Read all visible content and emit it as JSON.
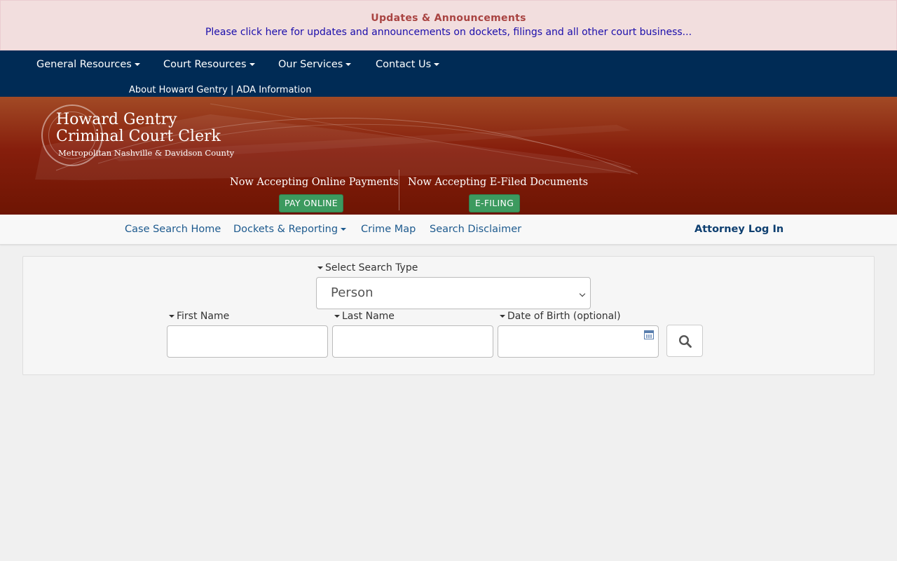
{
  "announcement": {
    "title": "Updates & Announcements",
    "link_text": "Please click here for updates and announcements on dockets, filings and all other court business..."
  },
  "top_nav": {
    "items": [
      {
        "label": "General Resources"
      },
      {
        "label": "Court Resources"
      },
      {
        "label": "Our Services"
      },
      {
        "label": "Contact Us"
      }
    ],
    "sub_links": {
      "about": "About Howard Gentry",
      "separator": " | ",
      "ada": "ADA Information"
    }
  },
  "banner": {
    "brand_name": "Howard Gentry",
    "brand_title": "Criminal Court Clerk",
    "brand_region": "Metropolitan Nashville & Davidson County",
    "payments_text": "Now Accepting Online Payments",
    "pay_button": "PAY ONLINE",
    "efile_text": "Now Accepting E-Filed Documents",
    "efile_button": "E-FILING"
  },
  "secondary_nav": {
    "items": [
      {
        "label": "Case Search Home"
      },
      {
        "label": "Dockets & Reporting"
      },
      {
        "label": "Crime Map"
      },
      {
        "label": "Search Disclaimer"
      }
    ],
    "login": "Attorney Log In"
  },
  "search_form": {
    "search_type_label": "Select Search Type",
    "search_type_value": "Person",
    "first_name_label": "First Name",
    "first_name_value": "",
    "last_name_label": "Last Name",
    "last_name_value": "",
    "dob_label": "Date of Birth (optional)",
    "dob_value": ""
  },
  "icons": {
    "search": "search-icon",
    "calendar": "calendar-icon",
    "seal": "court-seal-logo"
  },
  "colors": {
    "top_nav_bg": "#002b55",
    "banner_bg": "#861e0c",
    "button_green": "#3c9a5f",
    "link_blue": "#1d5a8e",
    "announce_bg": "#f2dede",
    "announce_title": "#a94442"
  }
}
